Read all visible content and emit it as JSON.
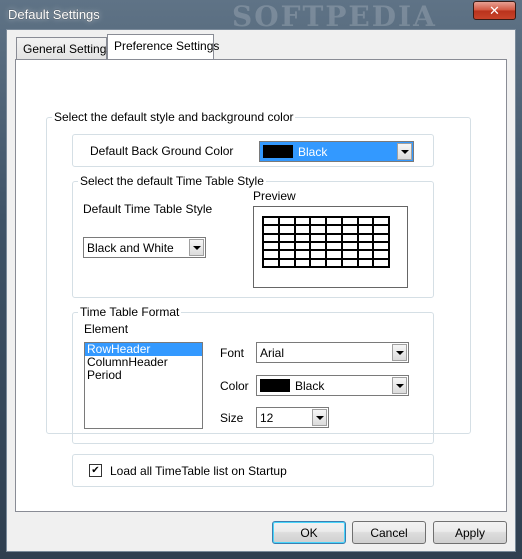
{
  "window": {
    "title": "Default Settings",
    "watermark": "SOFTPEDIA",
    "close_glyph": "✕"
  },
  "tabs": [
    {
      "label": "General Settings",
      "active": false
    },
    {
      "label": "Preference Settings",
      "active": true
    }
  ],
  "style_group": {
    "title": "Select the default style and background color",
    "back_ground_label": "Default Back Ground Color",
    "back_ground_value": "Black",
    "back_ground_swatch": "#000000"
  },
  "timetable_style_group": {
    "title": "Select the default Time Table Style",
    "style_label": "Default Time Table Style",
    "style_value": "Black and White",
    "preview_label": "Preview"
  },
  "format_group": {
    "title": "Time Table Format",
    "element_label": "Element",
    "elements": [
      "RowHeader",
      "ColumnHeader",
      "Period"
    ],
    "selected_element": "RowHeader",
    "font_label": "Font",
    "font_value": "Arial",
    "color_label": "Color",
    "color_value": "Black",
    "color_swatch": "#000000",
    "size_label": "Size",
    "size_value": "12"
  },
  "startup": {
    "label": "Load all TimeTable list on Startup",
    "checked": true,
    "check_glyph": "✔"
  },
  "buttons": {
    "ok": "OK",
    "cancel": "Cancel",
    "apply": "Apply"
  },
  "colors": {
    "selection": "#3399ff",
    "accent_border": "#3c7fb1"
  }
}
